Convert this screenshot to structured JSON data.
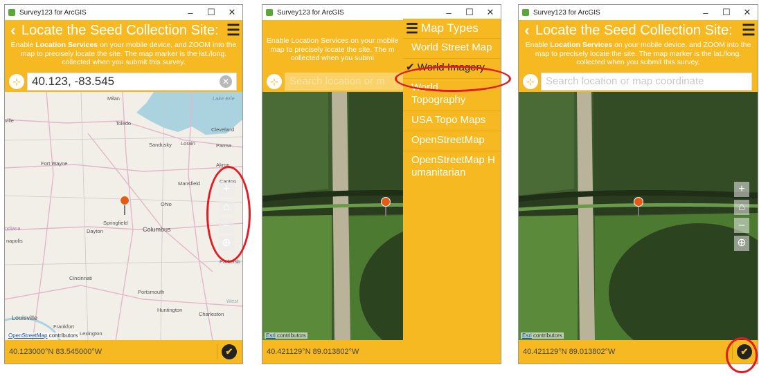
{
  "app_name": "Survey123 for ArcGIS",
  "screens": [
    {
      "header_title": "Locate the Seed Collection Site:",
      "instructions_pre": "Enable ",
      "instructions_bold": "Location Services",
      "instructions_post": " on your mobile device, and ZOOM into the map to precisely locate the site. The map marker is the lat./long. collected when you submit this survey.",
      "search_value": "40.123, -83.545",
      "map_labels": [
        "Milan",
        "Toledo",
        "Cleveland",
        "Sandusky",
        "Lorain",
        "Parma",
        "Fort Wayne",
        "Akron",
        "Mansfield",
        "Canton",
        "Ohio",
        "Springfield",
        "Dayton",
        "Columbus",
        "napolis",
        "Parkersb",
        "Cincinnati",
        "Portsmouth",
        "Huntington",
        "Charleston",
        "Louisville",
        "Frankfort",
        "Lexington",
        "West",
        "Lake Erie",
        "ndiana",
        "ville"
      ],
      "attribution_link": "OpenStreetMap",
      "attribution_text": " contributors",
      "coords": "40.123000°N 83.545000°W"
    },
    {
      "header_title": "Map Types",
      "instructions_text": "Enable Location Services on your mobile map to precisely locate the site. The m collected when you submi",
      "search_placeholder": "Search location or m",
      "map_types": [
        {
          "label": "World Street Map",
          "selected": false
        },
        {
          "label": "World Imagery",
          "selected": true
        },
        {
          "label": "World Topography",
          "selected": false
        },
        {
          "label": "USA Topo Maps",
          "selected": false
        },
        {
          "label": "OpenStreetMap",
          "selected": false
        },
        {
          "label": "OpenStreetMap Humanitarian",
          "selected": false
        }
      ],
      "attribution_link": "Esri",
      "attribution_text": " contributors",
      "coords": "40.421129°N 89.013802°W"
    },
    {
      "header_title": "Locate the Seed Collection Site:",
      "instructions_pre": "Enable ",
      "instructions_bold": "Location Services",
      "instructions_post": " on your mobile device, and ZOOM into the map to precisely locate the site. The map marker is the lat./long. collected when you submit this survey.",
      "search_placeholder": "Search location or map coordinate",
      "attribution_link": "Esri",
      "attribution_text": " contributors",
      "coords": "40.421129°N 89.013802°W"
    }
  ],
  "icons": [
    "app-icon",
    "back-icon",
    "hamburger-menu-icon",
    "locate-icon",
    "clear-icon",
    "zoom-in-icon",
    "home-icon",
    "zoom-out-icon",
    "gps-icon",
    "map-pin-icon",
    "checkmark-icon"
  ],
  "colors": {
    "accent": "#f6b921",
    "annotation": "#e31b23",
    "pin": "#e45b16"
  }
}
